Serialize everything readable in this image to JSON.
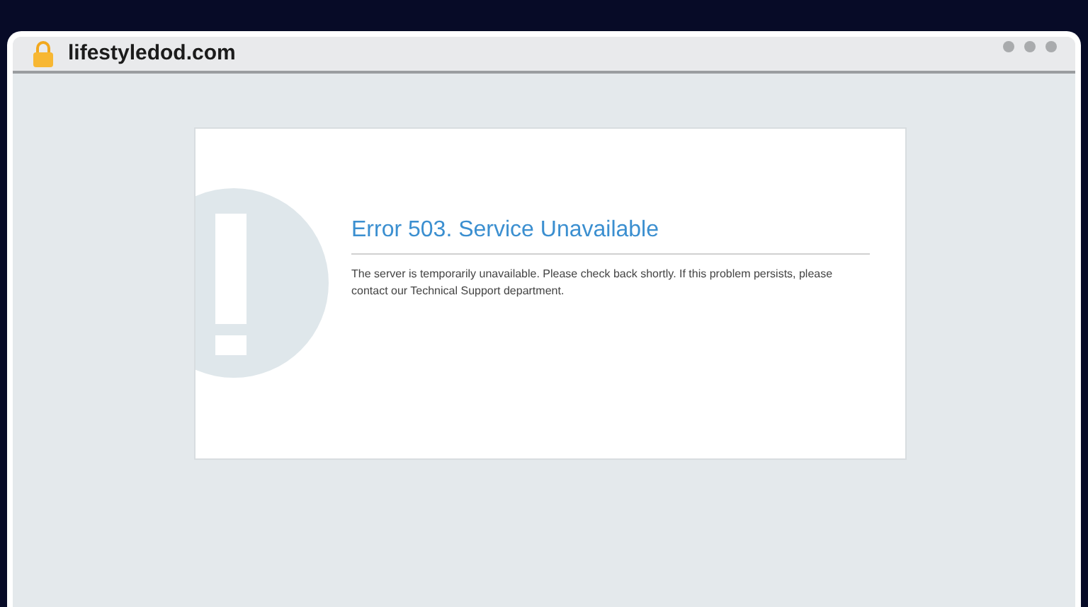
{
  "browser": {
    "address": "lifestyledod.com"
  },
  "error_page": {
    "title": "Error 503. Service Unavailable",
    "message": "The server is temporarily unavailable. Please check back shortly. If this problem persists, please contact our Technical Support department."
  }
}
